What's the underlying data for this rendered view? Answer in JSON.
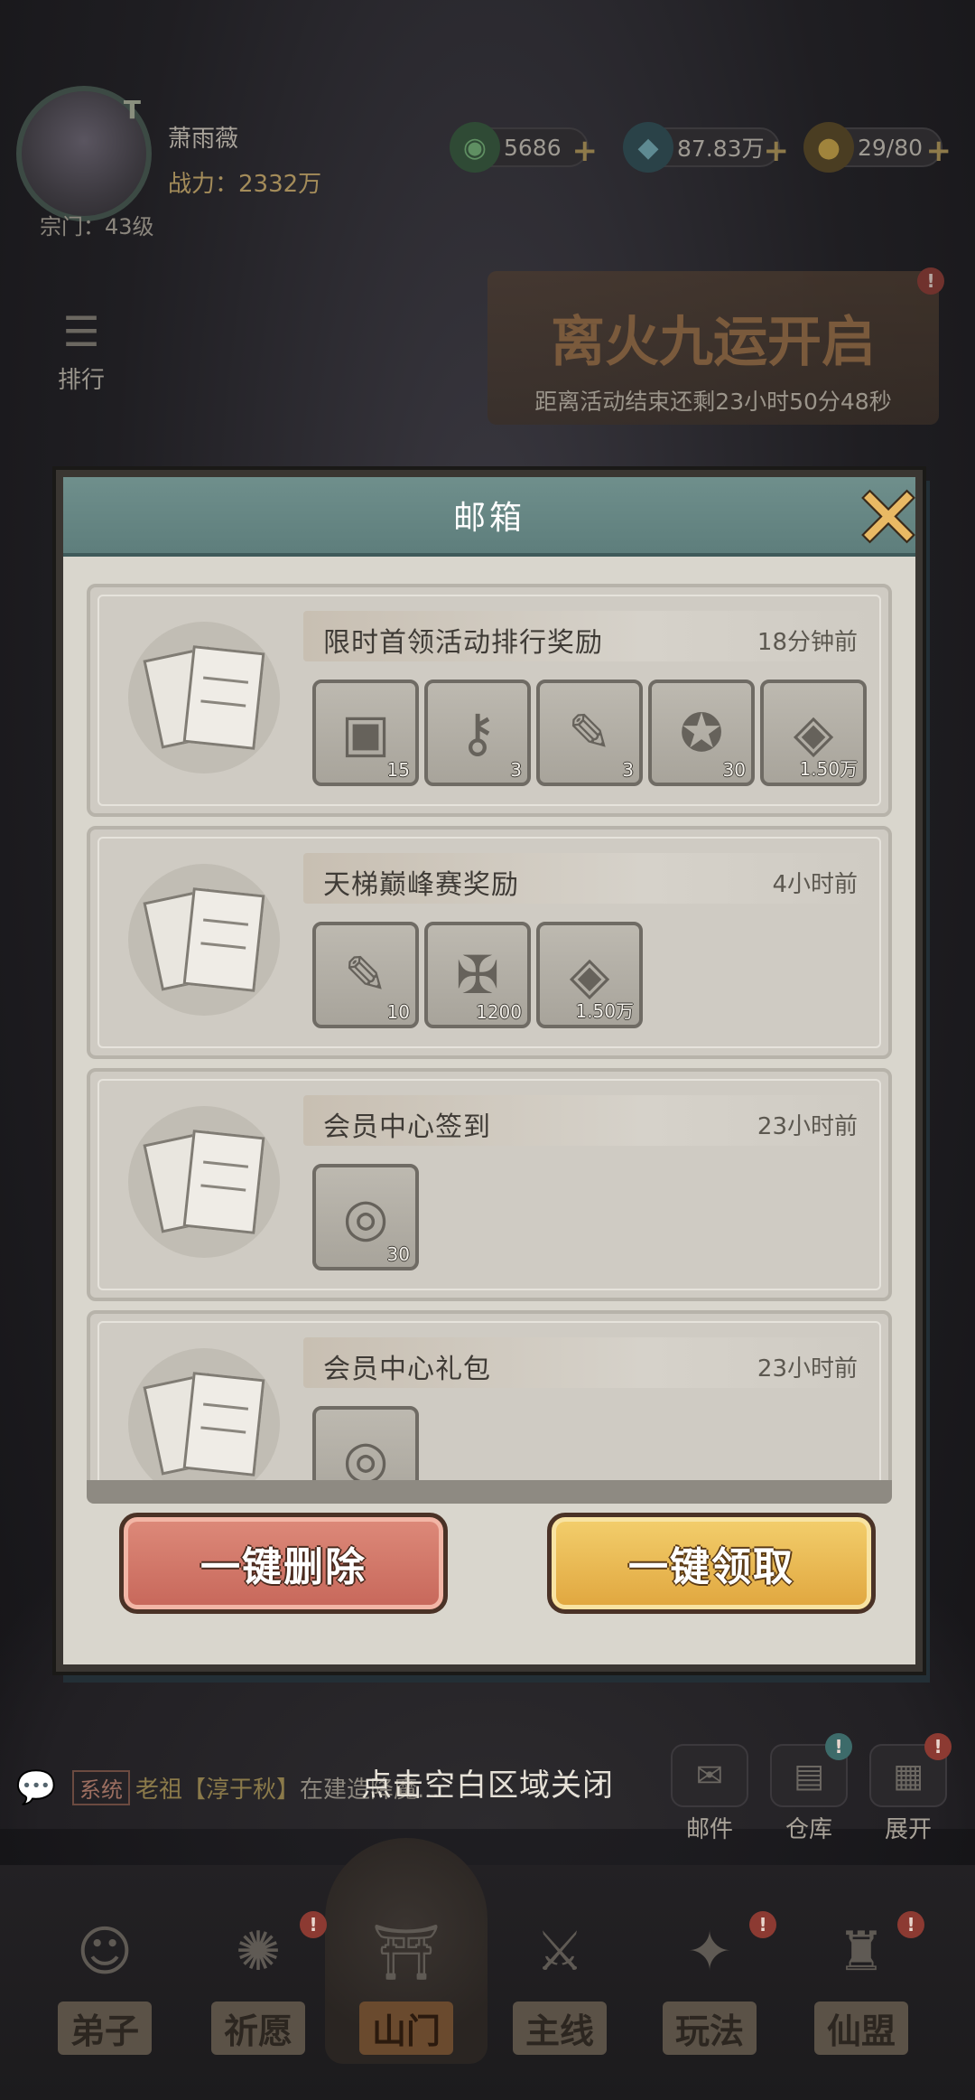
{
  "player": {
    "name": "萧雨薇",
    "vip": "T",
    "power": "战力：2332万",
    "sect_level": "宗门：43级"
  },
  "resources": [
    {
      "icon": "jade-icon",
      "value": "5686"
    },
    {
      "icon": "spirit-stone-icon",
      "value": "87.83万"
    },
    {
      "icon": "stamina-gourd-icon",
      "value": "29/80"
    }
  ],
  "banner": {
    "title": "离火九运开启",
    "subtitle": "距离活动结束还剩23小时50分48秒"
  },
  "side": {
    "ranking": "排行"
  },
  "mailbox": {
    "title": "邮箱",
    "items": [
      {
        "title": "限时首领活动排行奖励",
        "time": "18分钟前",
        "rewards": [
          {
            "icon": "treasure-chest-icon",
            "glyph": "▣",
            "count": "15"
          },
          {
            "icon": "key-icon",
            "glyph": "⚷",
            "count": "3"
          },
          {
            "icon": "scroll-ticket-icon",
            "glyph": "✎",
            "count": "3"
          },
          {
            "icon": "star-coin-icon",
            "glyph": "✪",
            "count": "30"
          },
          {
            "icon": "spirit-ore-icon",
            "glyph": "◈",
            "count": "1.50万"
          }
        ]
      },
      {
        "title": "天梯巅峰赛奖励",
        "time": "4小时前",
        "rewards": [
          {
            "icon": "ticket-icon",
            "glyph": "✎",
            "count": "10"
          },
          {
            "icon": "sword-badge-icon",
            "glyph": "✠",
            "count": "1200"
          },
          {
            "icon": "spirit-ore-icon",
            "glyph": "◈",
            "count": "1.50万"
          }
        ]
      },
      {
        "title": "会员中心签到",
        "time": "23小时前",
        "rewards": [
          {
            "icon": "dragon-coin-icon",
            "glyph": "◎",
            "count": "30"
          }
        ]
      },
      {
        "title": "会员中心礼包",
        "time": "23小时前",
        "rewards": [
          {
            "icon": "dragon-coin-icon",
            "glyph": "◎",
            "count": ""
          }
        ]
      }
    ],
    "delete_all": "一键删除",
    "claim_all": "一键领取"
  },
  "close_hint": "点击空白区域关闭",
  "chat": {
    "channel": "系统",
    "speaker": "老祖【淳于秋】",
    "message": "在建造降魔..."
  },
  "quick_buttons": [
    {
      "label": "邮件",
      "icon": "mail-icon"
    },
    {
      "label": "仓库",
      "icon": "warehouse-icon"
    },
    {
      "label": "展开",
      "icon": "expand-icon"
    }
  ],
  "nav": [
    {
      "label": "弟子",
      "icon": "disciple-icon"
    },
    {
      "label": "祈愿",
      "icon": "wish-icon"
    },
    {
      "label": "山门",
      "icon": "sect-gate-icon"
    },
    {
      "label": "主线",
      "icon": "main-quest-icon"
    },
    {
      "label": "玩法",
      "icon": "gameplay-icon"
    },
    {
      "label": "仙盟",
      "icon": "alliance-icon"
    }
  ]
}
